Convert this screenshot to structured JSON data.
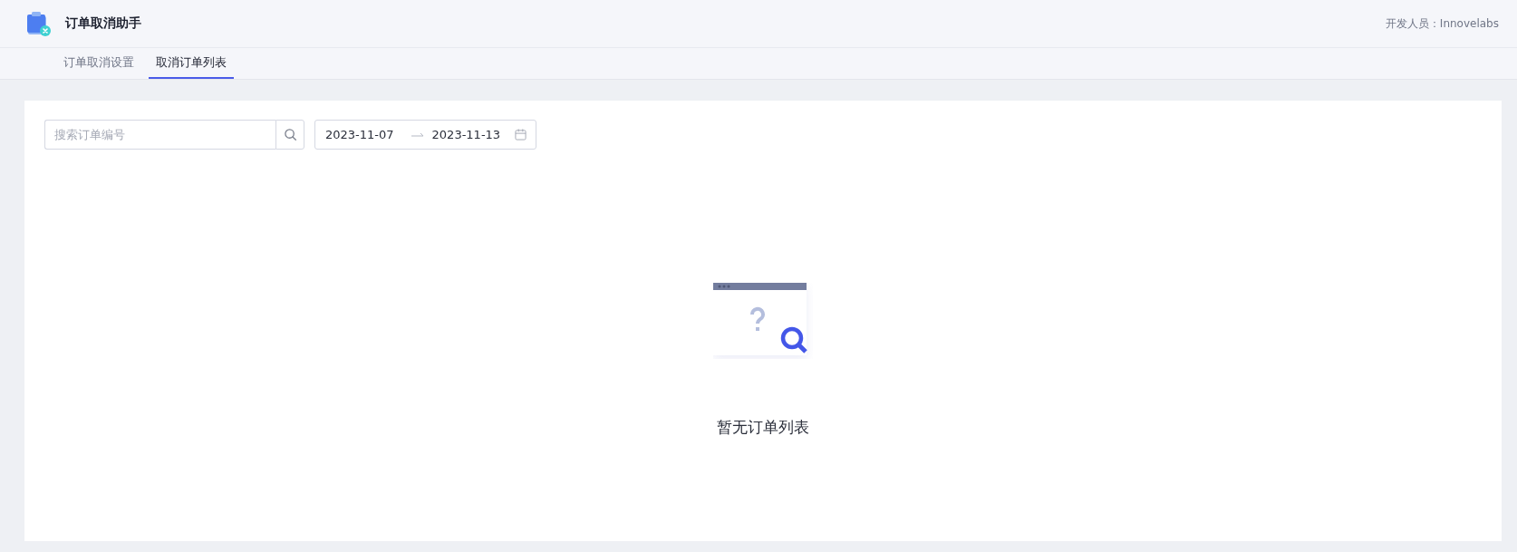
{
  "app": {
    "title": "订单取消助手",
    "developer": "开发人员：Innovelabs"
  },
  "tabs": [
    {
      "label": "订单取消设置",
      "selected": false
    },
    {
      "label": "取消订单列表",
      "selected": true
    }
  ],
  "search": {
    "placeholder": "搜索订单编号"
  },
  "date_range": {
    "start": "2023-11-07",
    "end": "2023-11-13"
  },
  "empty_state": {
    "message": "暂无订单列表"
  }
}
